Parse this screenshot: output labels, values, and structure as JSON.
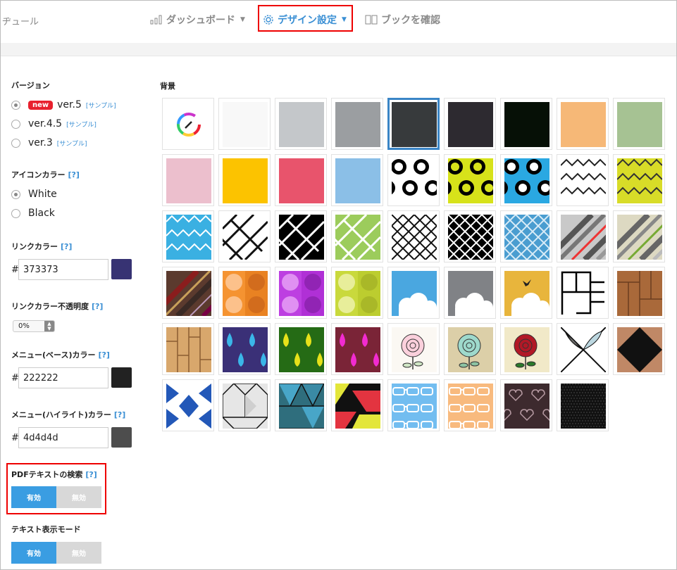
{
  "header": {
    "brand_partial": "ヂュール",
    "nav": [
      {
        "label": "ダッシュボード",
        "icon": "bar-chart-icon"
      },
      {
        "label": "デザイン設定",
        "icon": "gear-icon"
      },
      {
        "label": "ブックを確認",
        "icon": "book-icon"
      }
    ],
    "active_nav": "デザイン設定"
  },
  "version": {
    "title": "バージョン",
    "options": [
      {
        "label": "ver.5",
        "badge": "new",
        "sample": "[サンプル]",
        "selected": true
      },
      {
        "label": "ver.4.5",
        "sample": "[サンプル]",
        "selected": false
      },
      {
        "label": "ver.3",
        "sample": "[サンプル]",
        "selected": false
      }
    ]
  },
  "icon_color": {
    "title": "アイコンカラー",
    "help": "[?]",
    "options": [
      {
        "label": "White",
        "selected": true
      },
      {
        "label": "Black",
        "selected": false
      }
    ]
  },
  "link_color": {
    "title": "リンクカラー",
    "help": "[?]",
    "prefix": "#",
    "value": "373373",
    "swatch": "#373373"
  },
  "link_opacity": {
    "title": "リンクカラー不透明度",
    "help": "[?]",
    "value": "0%"
  },
  "menu_base_color": {
    "title": "メニュー(ベース)カラー",
    "help": "[?]",
    "prefix": "#",
    "value": "222222",
    "swatch": "#222222"
  },
  "menu_highlight_color": {
    "title": "メニュー(ハイライト)カラー",
    "help": "[?]",
    "prefix": "#",
    "value": "4d4d4d",
    "swatch": "#4d4d4d"
  },
  "pdf_search": {
    "title": "PDFテキストの検索",
    "help": "[?]",
    "on_label": "有効",
    "off_label": "無効",
    "state": "on"
  },
  "text_display_mode": {
    "title": "テキスト表示モード",
    "on_label": "有効",
    "off_label": "無効",
    "state": "on"
  },
  "background": {
    "title": "背景",
    "selected_index": 4,
    "tiles": [
      "color-picker",
      "#f8f8f8",
      "#c4c7ca",
      "#9b9ea1",
      "#373a3c",
      "#2d2a30",
      "#061006",
      "#f6b877",
      "#a6c293",
      "#ecbfcd",
      "#fcc300",
      "#e8546c",
      "#8bbfe7",
      "circles-black-white",
      "circles-lime",
      "circles-blue",
      "zigzag-white",
      "zigzag-yellow",
      "zigzag-blue",
      "herringbone-white",
      "herringbone-black",
      "herringbone-green",
      "lattice-white",
      "lattice-black",
      "lattice-blue",
      "stripes-gray-red",
      "stripes-beige-green",
      "stripes-brown",
      "dots-orange",
      "dots-purple",
      "dots-lime",
      "cloud-blue",
      "cloud-gray",
      "cloud-bird-orange",
      "bricks-outline",
      "wood-parquet",
      "wood-planks",
      "drops-navy",
      "drops-green",
      "drops-maroon",
      "rose-white",
      "rose-teal",
      "rose-red",
      "leaf-curves",
      "curves-brown",
      "quatrefoil-blue",
      "cubes-gray",
      "cubes-teal",
      "blocks-red-yellow",
      "glasses-blue",
      "glasses-orange",
      "hearts-dark",
      "carbon-black"
    ]
  }
}
